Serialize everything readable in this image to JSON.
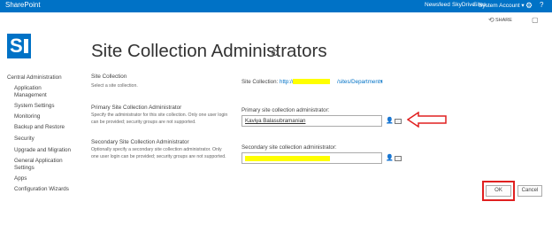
{
  "suite_bar": {
    "brand": "SharePoint",
    "links": [
      "Newsfeed",
      "SkyDrive",
      "Sites"
    ],
    "active_link": "Sites",
    "user": "System Account ▾",
    "gear_icon": "gear-icon",
    "help_icon": "help-icon",
    "color": "#0072c6"
  },
  "ribbon": {
    "share_label": "SHARE",
    "share_icon": "share-icon",
    "focus_icon": "focus-icon"
  },
  "page": {
    "title": "Site Collection Administrators",
    "info_glyph": "i"
  },
  "left_nav": [
    "Central Administration",
    "Application",
    "Management",
    "System Settings",
    "Monitoring",
    "Backup and Restore",
    "Security",
    "Upgrade and Migration",
    "General Application",
    "Settings",
    "Apps",
    "Configuration Wizards"
  ],
  "site_collection": {
    "title": "Site Collection",
    "description": "Select a site collection.",
    "label": "Site Collection:",
    "url_prefix": "http://",
    "url_suffix": "/sites/Departments",
    "dropdown_glyph": "▾"
  },
  "primary_admin": {
    "title": "Primary Site Collection Administrator",
    "description": "Specify the administrator for this site collection. Only one user login can be provided; security groups are not supported.",
    "field_label": "Primary site collection administrator:",
    "value": "Kaviya Balasubramanian"
  },
  "secondary_admin": {
    "title": "Secondary Site Collection Administrator",
    "description": "Optionally specify a secondary site collection administrator. Only one user login can be provided; security groups are not supported.",
    "field_label": "Secondary site collection administrator:"
  },
  "buttons": {
    "ok": "OK",
    "cancel": "Cancel"
  },
  "annotation_color": "#e02020"
}
